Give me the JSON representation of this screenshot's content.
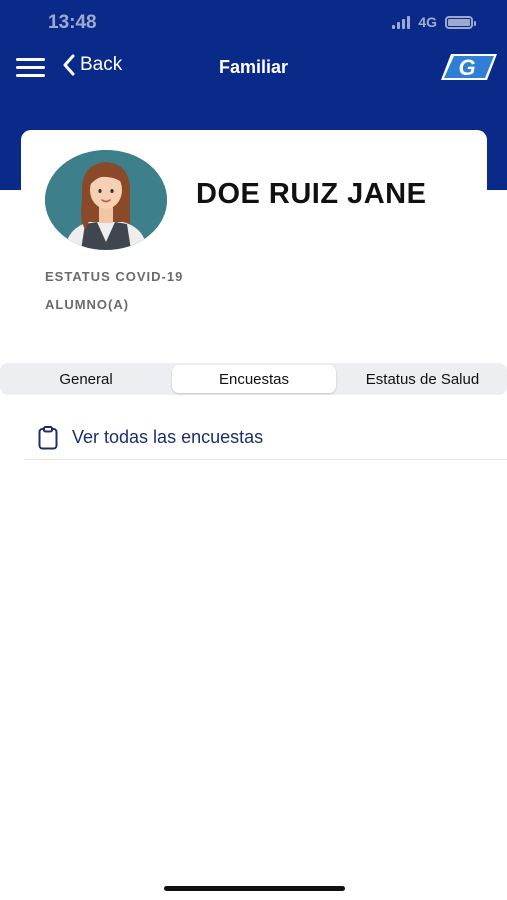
{
  "status_bar": {
    "time": "13:48",
    "network": "4G",
    "icons": [
      "signal-icon",
      "battery-icon"
    ]
  },
  "nav": {
    "menu_icon": "hamburger-menu-icon",
    "back_icon": "chevron-left-icon",
    "back_label": "Back",
    "title": "Familiar",
    "logo_text": "G"
  },
  "profile": {
    "name": "DOE RUIZ JANE",
    "status_label": "ESTATUS COVID-19",
    "role": "ALUMNO(A)",
    "avatar_icon": "woman-avatar-icon"
  },
  "tabs": [
    {
      "label": "General",
      "active": false
    },
    {
      "label": "Encuestas",
      "active": true
    },
    {
      "label": "Estatus de Salud",
      "active": false
    }
  ],
  "surveys": {
    "link_label": "Ver todas las encuestas",
    "icon": "clipboard-icon"
  },
  "colors": {
    "header": "#0a2a8a",
    "link_text": "#1c2e6e",
    "avatar_bg": "#3e7f8c",
    "tab_bar": "#eceef1"
  }
}
